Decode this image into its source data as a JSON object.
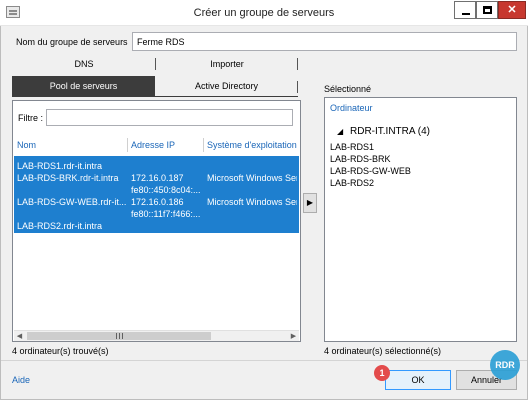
{
  "window": {
    "title": "Créer un groupe de serveurs",
    "controls": {
      "close": "✕"
    }
  },
  "form": {
    "group_name_label": "Nom du groupe de serveurs",
    "group_name_value": "Ferme RDS"
  },
  "tabs": {
    "dns": "DNS",
    "import": "Importer",
    "pool": "Pool de serveurs",
    "active_directory": "Active Directory"
  },
  "filter": {
    "label": "Filtre :",
    "value": ""
  },
  "server_table": {
    "columns": [
      "Nom",
      "Adresse IP",
      "Système d'exploitation"
    ],
    "rows": [
      {
        "name": "LAB-RDS1.rdr-it.intra",
        "ip": "",
        "ip2": "",
        "os": ""
      },
      {
        "name": "LAB-RDS-BRK.rdr-it.intra",
        "ip": "172.16.0.187",
        "ip2": "fe80::450:8c04:...",
        "os": "Microsoft Windows Ser"
      },
      {
        "name": "LAB-RDS-GW-WEB.rdr-it...",
        "ip": "172.16.0.186",
        "ip2": "fe80::11f7:f466:...",
        "os": "Microsoft Windows Ser"
      },
      {
        "name": "LAB-RDS2.rdr-it.intra",
        "ip": "",
        "ip2": "",
        "os": ""
      }
    ],
    "found_status": "4 ordinateur(s) trouvé(s)"
  },
  "move_button": "▶",
  "selected": {
    "label": "Sélectionné",
    "column": "Ordinateur",
    "domain": "RDR-IT.INTRA (4)",
    "items": [
      "LAB-RDS1",
      "LAB-RDS-BRK",
      "LAB-RDS-GW-WEB",
      "LAB-RDS2"
    ],
    "status": "4 ordinateur(s) sélectionné(s)"
  },
  "footer": {
    "help": "Aide",
    "ok": "OK",
    "cancel": "Annuler",
    "step_badge": "1",
    "logo": "RDR"
  },
  "colors": {
    "selection": "#1e7fcf",
    "active_tab": "#3c3c3c",
    "close_button": "#c7382f",
    "link": "#1a66b8"
  }
}
